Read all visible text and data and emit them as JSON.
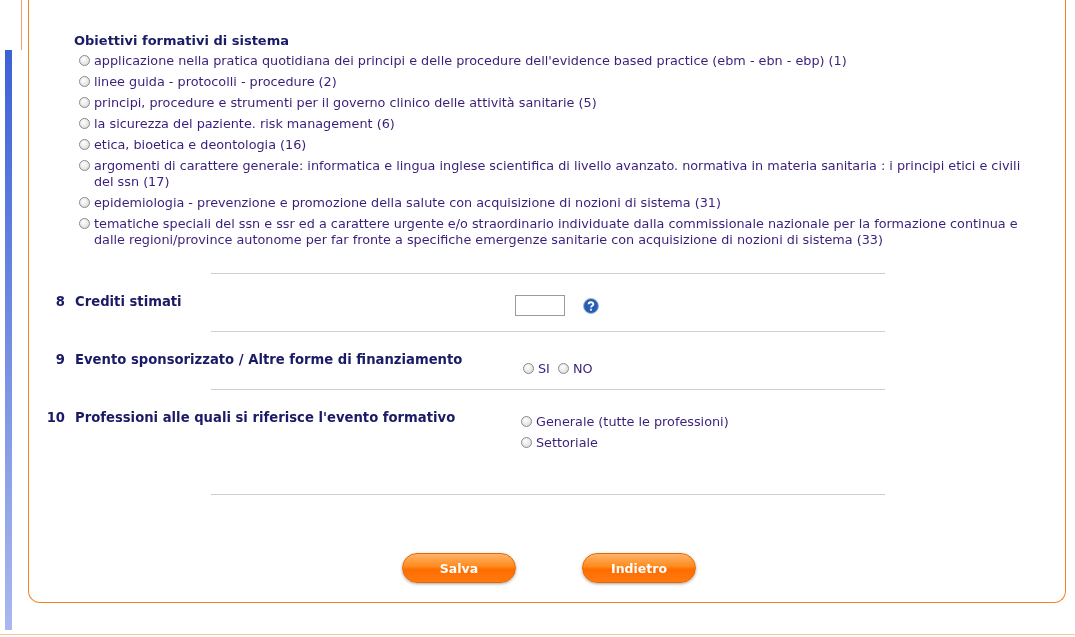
{
  "section": {
    "title": "Obiettivi formativi di sistema",
    "options": [
      {
        "label": "applicazione nella pratica quotidiana dei principi e delle procedure dell'evidence based practice (ebm - ebn - ebp) (1)",
        "selected": false
      },
      {
        "label": "linee guida - protocolli - procedure (2)",
        "selected": false
      },
      {
        "label": "principi, procedure e strumenti per il governo clinico delle attività sanitarie (5)",
        "selected": false
      },
      {
        "label": "la sicurezza del paziente. risk management (6)",
        "selected": false
      },
      {
        "label": "etica, bioetica e deontologia (16)",
        "selected": false
      },
      {
        "label": "argomenti di carattere generale: informatica e lingua inglese scientifica di livello avanzato. normativa in materia sanitaria : i principi etici e civili del ssn (17)",
        "selected": false
      },
      {
        "label": "epidemiologia - prevenzione e promozione della salute con acquisizione di nozioni di sistema (31)",
        "selected": false
      },
      {
        "label": "tematiche speciali del ssn e ssr ed a carattere urgente e/o straordinario individuate dalla commissionale nazionale per la formazione continua e dalle regioni/province autonome per far fronte a specifiche emergenze sanitarie con acquisizione di nozioni di sistema (33)",
        "selected": false
      }
    ]
  },
  "fields": [
    {
      "number": "8",
      "label": "Crediti stimati",
      "kind": "input",
      "help": true
    },
    {
      "number": "9",
      "label": "Evento sponsorizzato / Altre forme di finanziamento",
      "kind": "radio-inline",
      "options": [
        {
          "label": "SI",
          "selected": false
        },
        {
          "label": "NO",
          "selected": false
        }
      ]
    },
    {
      "number": "10",
      "label": "Professioni alle quali si riferisce l'evento formativo",
      "kind": "radio-stacked",
      "options": [
        {
          "label": "Generale (tutte le professioni)",
          "selected": false
        },
        {
          "label": "Settoriale",
          "selected": false
        }
      ]
    }
  ],
  "buttons": [
    "Salva",
    "Indietro"
  ]
}
